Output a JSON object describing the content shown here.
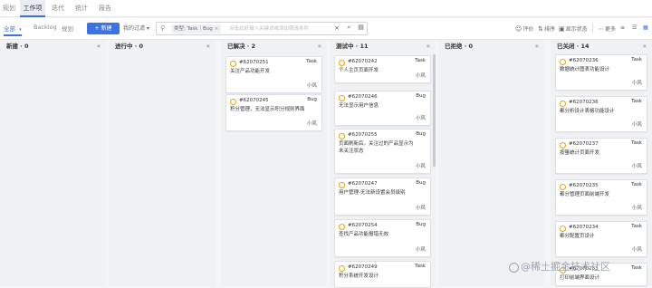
{
  "topnav": {
    "tabs": [
      "规划",
      "工作项",
      "迭代",
      "统计",
      "报告"
    ],
    "active_index": 1
  },
  "toolbar": {
    "view_tabs": [
      {
        "label": "全部",
        "has_caret": true
      },
      {
        "label": "Backlog"
      },
      {
        "label": "规划"
      }
    ],
    "new_button": "+ 新建",
    "filter_select": "我的过滤 ▾",
    "search": {
      "chip_label": "类型: Task｜Bug",
      "chip_close": "×",
      "placeholder": "点击此处输入关键词或添加筛选条件",
      "clear": "×"
    },
    "right_tools": [
      {
        "icon": "☺",
        "label": "评价"
      },
      {
        "icon": "⇅",
        "label": "排序"
      },
      {
        "icon": "▣",
        "label": "显示状态"
      },
      {
        "icon": "⋯",
        "label": "更多"
      }
    ],
    "view_icons": [
      "≡",
      "☰",
      "▦"
    ]
  },
  "columns": [
    {
      "title": "新建 · 0",
      "collapse": "«",
      "cards": []
    },
    {
      "title": "进行中 · 0",
      "collapse": "«",
      "cards": []
    },
    {
      "title": "已解决 · 2",
      "collapse": "«",
      "cards": [
        {
          "id": "#62070251",
          "type": "Task",
          "title": "关注产品功能开发",
          "user": "小风"
        },
        {
          "id": "#62070245",
          "type": "Bug",
          "title": "积分管理，无法显示积分规则界面",
          "user": "小风"
        }
      ]
    },
    {
      "title": "测试中 · 11",
      "collapse": "«",
      "cards": [
        {
          "id": "#62070242",
          "type": "Task",
          "title": "个人主页页面开发",
          "user": "小风"
        },
        {
          "id": "#62070246",
          "type": "Bug",
          "title": "无法显示用户信息",
          "user": "小风"
        },
        {
          "id": "#62070255",
          "type": "Bug",
          "title": "页面刷新后，关注过的产品显示为未关注状态",
          "user": "小风"
        },
        {
          "id": "#62070247",
          "type": "Bug",
          "title": "用户管理-无法新设置会员级别",
          "user": "小风"
        },
        {
          "id": "#62070254",
          "type": "Bug",
          "title": "查找产品功能报错无效",
          "user": "小风"
        },
        {
          "id": "#62070249",
          "type": "Task",
          "title": "积分系统开发设计",
          "user": ""
        }
      ]
    },
    {
      "title": "已拒绝 · 0",
      "collapse": "«",
      "cards": []
    },
    {
      "title": "已关闭 · 14",
      "collapse": "«",
      "cards": [
        {
          "id": "#62070236",
          "type": "Task",
          "title": "数据统计图表功能设计",
          "user": "小风"
        },
        {
          "id": "#62070236",
          "type": "Task",
          "title": "都分析设计表格功能设计",
          "user": "小风"
        },
        {
          "id": "#62070237",
          "type": "Task",
          "title": "按量统计页面开发",
          "user": "小风"
        },
        {
          "id": "#62070235",
          "type": "Task",
          "title": "都分管理页面前端开发",
          "user": "小风"
        },
        {
          "id": "#62070234",
          "type": "Task",
          "title": "都分配置页设计",
          "user": "小风"
        },
        {
          "id": "#62070233",
          "type": "Task",
          "title": "打印前端界面设计",
          "user": ""
        }
      ]
    }
  ],
  "watermark": "@稀土掘金技术社区",
  "colors": {
    "accent": "#3b73e6",
    "status_dot": "#e9a400",
    "board_bg": "#f0f1f3"
  }
}
